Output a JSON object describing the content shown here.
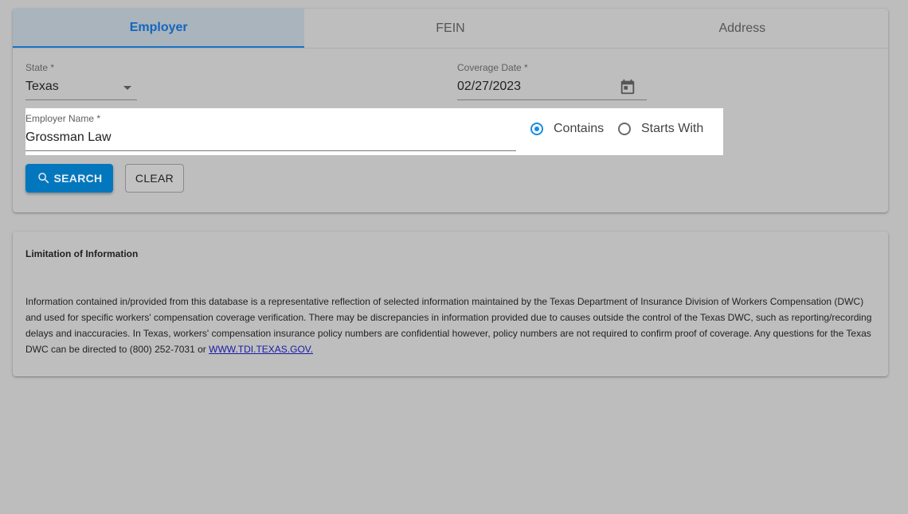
{
  "tabs": [
    {
      "label": "Employer",
      "active": true
    },
    {
      "label": "FEIN",
      "active": false
    },
    {
      "label": "Address",
      "active": false
    }
  ],
  "form": {
    "state": {
      "label": "State *",
      "value": "Texas"
    },
    "coverage_date": {
      "label": "Coverage Date *",
      "value": "02/27/2023"
    },
    "employer_name": {
      "label": "Employer Name *",
      "value": "Grossman Law"
    },
    "match_options": [
      {
        "label": "Contains",
        "checked": true
      },
      {
        "label": "Starts With",
        "checked": false
      }
    ],
    "search_label": "SEARCH",
    "clear_label": "CLEAR"
  },
  "info": {
    "title": "Limitation of Information",
    "text": "Information contained in/provided from this database is a representative reflection of selected information maintained by the Texas Department of Insurance Division of Workers Compensation (DWC) and used for specific workers' compensation coverage verification. There may be discrepancies in information provided due to causes outside the control of the Texas DWC, such as reporting/recording delays and inaccuracies. In Texas, workers' compensation insurance policy numbers are confidential however, policy numbers are not required to confirm proof of coverage. Any questions for the Texas DWC can be directed to (800) 252-7031 or",
    "link": "WWW.TDI.TEXAS.GOV."
  },
  "colors": {
    "accent": "#1565c0",
    "button": "#0277bd",
    "radio": "#1a8be0"
  },
  "icons": {
    "state_dropdown": "chevron-down-icon",
    "coverage_date": "calendar-icon",
    "search_button": "search-icon"
  }
}
